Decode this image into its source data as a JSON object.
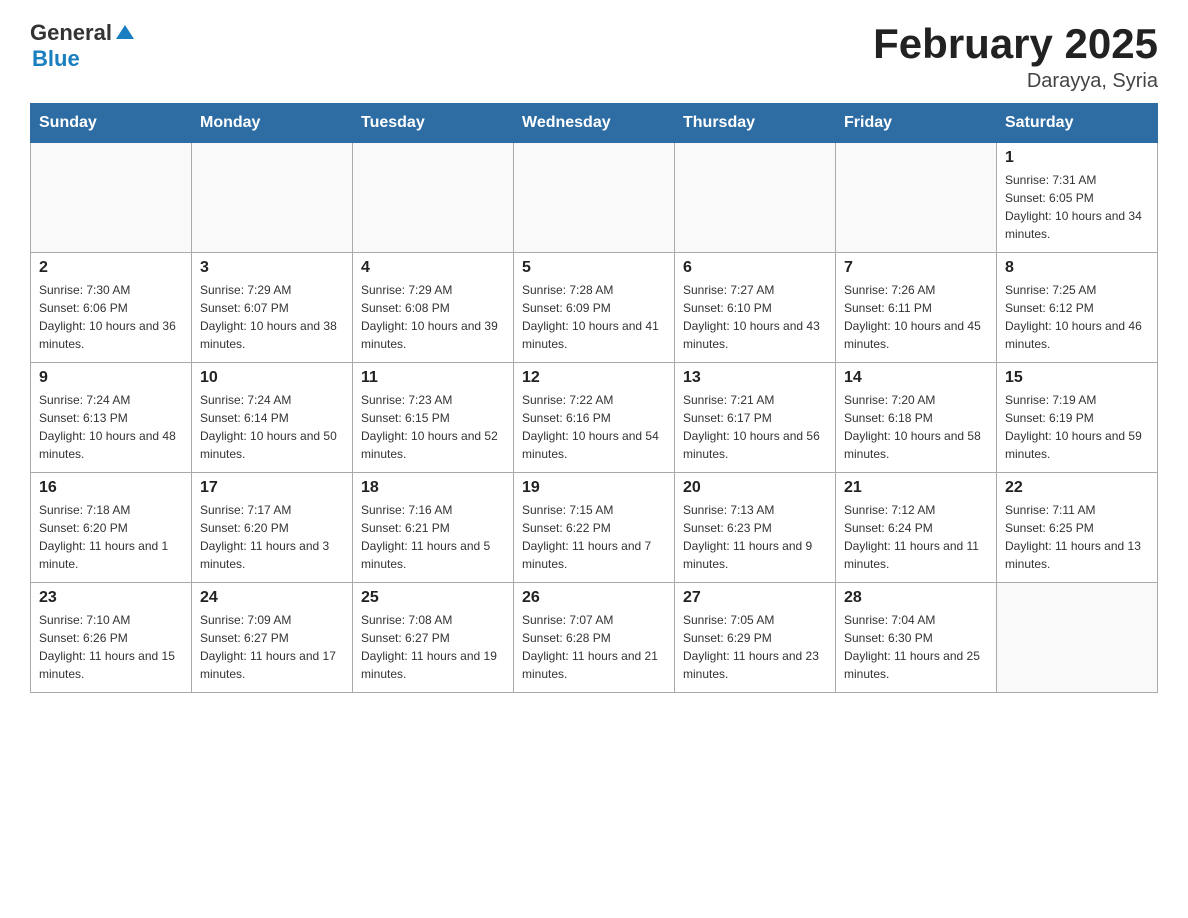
{
  "header": {
    "logo": {
      "general": "General",
      "arrow": "▲",
      "blue": "Blue"
    },
    "title": "February 2025",
    "subtitle": "Darayya, Syria"
  },
  "days_of_week": [
    "Sunday",
    "Monday",
    "Tuesday",
    "Wednesday",
    "Thursday",
    "Friday",
    "Saturday"
  ],
  "weeks": [
    [
      {
        "day": "",
        "sunrise": "",
        "sunset": "",
        "daylight": ""
      },
      {
        "day": "",
        "sunrise": "",
        "sunset": "",
        "daylight": ""
      },
      {
        "day": "",
        "sunrise": "",
        "sunset": "",
        "daylight": ""
      },
      {
        "day": "",
        "sunrise": "",
        "sunset": "",
        "daylight": ""
      },
      {
        "day": "",
        "sunrise": "",
        "sunset": "",
        "daylight": ""
      },
      {
        "day": "",
        "sunrise": "",
        "sunset": "",
        "daylight": ""
      },
      {
        "day": "1",
        "sunrise": "Sunrise: 7:31 AM",
        "sunset": "Sunset: 6:05 PM",
        "daylight": "Daylight: 10 hours and 34 minutes."
      }
    ],
    [
      {
        "day": "2",
        "sunrise": "Sunrise: 7:30 AM",
        "sunset": "Sunset: 6:06 PM",
        "daylight": "Daylight: 10 hours and 36 minutes."
      },
      {
        "day": "3",
        "sunrise": "Sunrise: 7:29 AM",
        "sunset": "Sunset: 6:07 PM",
        "daylight": "Daylight: 10 hours and 38 minutes."
      },
      {
        "day": "4",
        "sunrise": "Sunrise: 7:29 AM",
        "sunset": "Sunset: 6:08 PM",
        "daylight": "Daylight: 10 hours and 39 minutes."
      },
      {
        "day": "5",
        "sunrise": "Sunrise: 7:28 AM",
        "sunset": "Sunset: 6:09 PM",
        "daylight": "Daylight: 10 hours and 41 minutes."
      },
      {
        "day": "6",
        "sunrise": "Sunrise: 7:27 AM",
        "sunset": "Sunset: 6:10 PM",
        "daylight": "Daylight: 10 hours and 43 minutes."
      },
      {
        "day": "7",
        "sunrise": "Sunrise: 7:26 AM",
        "sunset": "Sunset: 6:11 PM",
        "daylight": "Daylight: 10 hours and 45 minutes."
      },
      {
        "day": "8",
        "sunrise": "Sunrise: 7:25 AM",
        "sunset": "Sunset: 6:12 PM",
        "daylight": "Daylight: 10 hours and 46 minutes."
      }
    ],
    [
      {
        "day": "9",
        "sunrise": "Sunrise: 7:24 AM",
        "sunset": "Sunset: 6:13 PM",
        "daylight": "Daylight: 10 hours and 48 minutes."
      },
      {
        "day": "10",
        "sunrise": "Sunrise: 7:24 AM",
        "sunset": "Sunset: 6:14 PM",
        "daylight": "Daylight: 10 hours and 50 minutes."
      },
      {
        "day": "11",
        "sunrise": "Sunrise: 7:23 AM",
        "sunset": "Sunset: 6:15 PM",
        "daylight": "Daylight: 10 hours and 52 minutes."
      },
      {
        "day": "12",
        "sunrise": "Sunrise: 7:22 AM",
        "sunset": "Sunset: 6:16 PM",
        "daylight": "Daylight: 10 hours and 54 minutes."
      },
      {
        "day": "13",
        "sunrise": "Sunrise: 7:21 AM",
        "sunset": "Sunset: 6:17 PM",
        "daylight": "Daylight: 10 hours and 56 minutes."
      },
      {
        "day": "14",
        "sunrise": "Sunrise: 7:20 AM",
        "sunset": "Sunset: 6:18 PM",
        "daylight": "Daylight: 10 hours and 58 minutes."
      },
      {
        "day": "15",
        "sunrise": "Sunrise: 7:19 AM",
        "sunset": "Sunset: 6:19 PM",
        "daylight": "Daylight: 10 hours and 59 minutes."
      }
    ],
    [
      {
        "day": "16",
        "sunrise": "Sunrise: 7:18 AM",
        "sunset": "Sunset: 6:20 PM",
        "daylight": "Daylight: 11 hours and 1 minute."
      },
      {
        "day": "17",
        "sunrise": "Sunrise: 7:17 AM",
        "sunset": "Sunset: 6:20 PM",
        "daylight": "Daylight: 11 hours and 3 minutes."
      },
      {
        "day": "18",
        "sunrise": "Sunrise: 7:16 AM",
        "sunset": "Sunset: 6:21 PM",
        "daylight": "Daylight: 11 hours and 5 minutes."
      },
      {
        "day": "19",
        "sunrise": "Sunrise: 7:15 AM",
        "sunset": "Sunset: 6:22 PM",
        "daylight": "Daylight: 11 hours and 7 minutes."
      },
      {
        "day": "20",
        "sunrise": "Sunrise: 7:13 AM",
        "sunset": "Sunset: 6:23 PM",
        "daylight": "Daylight: 11 hours and 9 minutes."
      },
      {
        "day": "21",
        "sunrise": "Sunrise: 7:12 AM",
        "sunset": "Sunset: 6:24 PM",
        "daylight": "Daylight: 11 hours and 11 minutes."
      },
      {
        "day": "22",
        "sunrise": "Sunrise: 7:11 AM",
        "sunset": "Sunset: 6:25 PM",
        "daylight": "Daylight: 11 hours and 13 minutes."
      }
    ],
    [
      {
        "day": "23",
        "sunrise": "Sunrise: 7:10 AM",
        "sunset": "Sunset: 6:26 PM",
        "daylight": "Daylight: 11 hours and 15 minutes."
      },
      {
        "day": "24",
        "sunrise": "Sunrise: 7:09 AM",
        "sunset": "Sunset: 6:27 PM",
        "daylight": "Daylight: 11 hours and 17 minutes."
      },
      {
        "day": "25",
        "sunrise": "Sunrise: 7:08 AM",
        "sunset": "Sunset: 6:27 PM",
        "daylight": "Daylight: 11 hours and 19 minutes."
      },
      {
        "day": "26",
        "sunrise": "Sunrise: 7:07 AM",
        "sunset": "Sunset: 6:28 PM",
        "daylight": "Daylight: 11 hours and 21 minutes."
      },
      {
        "day": "27",
        "sunrise": "Sunrise: 7:05 AM",
        "sunset": "Sunset: 6:29 PM",
        "daylight": "Daylight: 11 hours and 23 minutes."
      },
      {
        "day": "28",
        "sunrise": "Sunrise: 7:04 AM",
        "sunset": "Sunset: 6:30 PM",
        "daylight": "Daylight: 11 hours and 25 minutes."
      },
      {
        "day": "",
        "sunrise": "",
        "sunset": "",
        "daylight": ""
      }
    ]
  ]
}
